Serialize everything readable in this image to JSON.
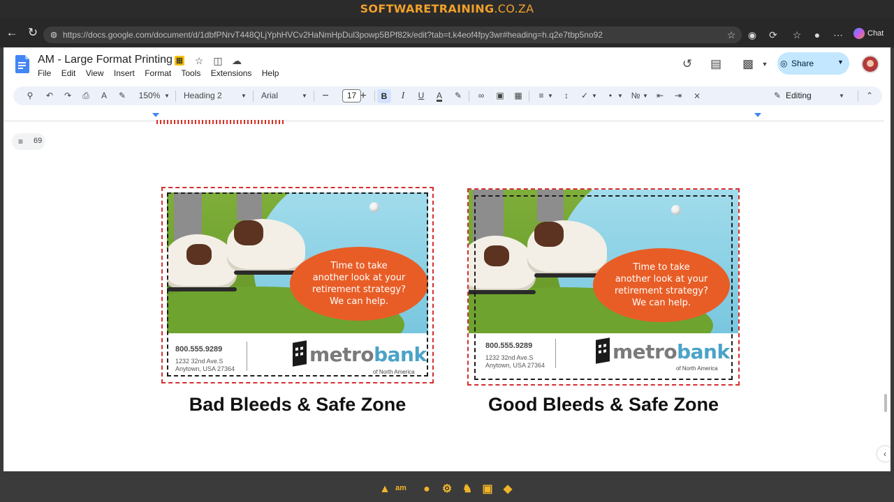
{
  "banner": {
    "part1": "SOFTWARE",
    "part2": "TRAINING",
    "part3": ".CO.ZA"
  },
  "browser": {
    "url": "https://docs.google.com/document/d/1dbfPNrvT448QLjYphHVCv2HaNmHpDul3powp5BPf82k/edit?tab=t.k4eof4fpy3wr#heading=h.q2e7tbp5no92",
    "chat_label": "Chat"
  },
  "doc": {
    "title": "AM - Large Format Printing",
    "menu": [
      "File",
      "Edit",
      "View",
      "Insert",
      "Format",
      "Tools",
      "Extensions",
      "Help"
    ],
    "share_label": "Share"
  },
  "toolbar": {
    "zoom": "150%",
    "style": "Heading 2",
    "font": "Arial",
    "font_size": "17",
    "mode": "Editing"
  },
  "outline": {
    "count": "69"
  },
  "figures": [
    {
      "caption": "Bad Bleeds & Safe Zone",
      "ad": {
        "line1": "Time to take",
        "line2": "another look at your",
        "line3": "retirement strategy?",
        "line4": "We can help.",
        "phone": "800.555.9289",
        "addr1": "1232 32nd Ave.S",
        "addr2": "Anytown, USA 27364",
        "brand_a": "metro",
        "brand_b": "bank",
        "brand_sub": "of North America"
      }
    },
    {
      "caption": "Good Bleeds & Safe Zone",
      "ad": {
        "line1": "Time to take",
        "line2": "another look at your",
        "line3": "retirement strategy?",
        "line4": "We can help.",
        "phone": "800.555.9289",
        "addr1": "1232 32nd Ave.S",
        "addr2": "Anytown, USA 27364",
        "brand_a": "metro",
        "brand_b": "bank",
        "brand_sub": "of North America"
      }
    }
  ],
  "taskbar": {
    "label": "am"
  },
  "colors": {
    "bleed": "#d32f2f",
    "safe": "#1c1c1c",
    "oval": "#e85d26",
    "brand_blue": "#4aa3c8",
    "share_bg": "#c2e7ff",
    "banner_text": "#f0a12b"
  },
  "icons": [
    "back-icon",
    "reload-icon",
    "star-icon",
    "extensions-icon",
    "history-icon",
    "comment-icon",
    "meet-icon",
    "search-icon",
    "undo-icon",
    "redo-icon",
    "print-icon",
    "spellcheck-icon",
    "paint-format-icon",
    "link-icon",
    "image-icon",
    "align-icon",
    "list-icon",
    "clear-format-icon"
  ]
}
